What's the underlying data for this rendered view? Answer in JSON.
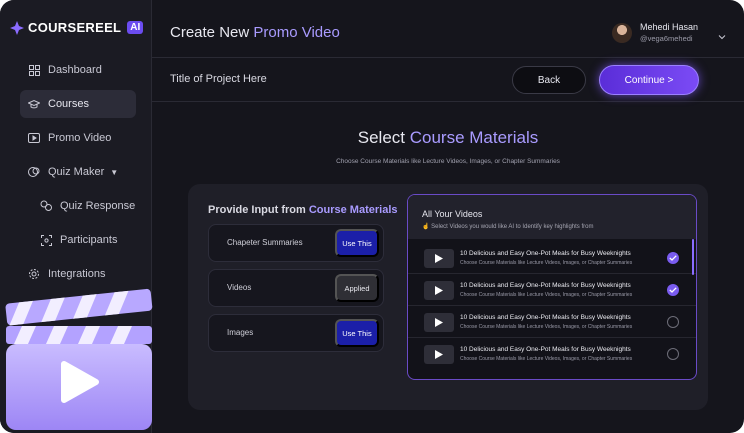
{
  "brand": {
    "name": "COURSEREEL",
    "badge": "AI"
  },
  "sidebar": {
    "items": [
      {
        "label": "Dashboard",
        "icon": "grid-icon"
      },
      {
        "label": "Courses",
        "icon": "graduation-cap-icon",
        "active": true
      },
      {
        "label": "Promo Video",
        "icon": "play-box-icon"
      },
      {
        "label": "Quiz Maker",
        "icon": "quiz-icon",
        "expandable": true
      },
      {
        "label": "Quiz Response",
        "icon": "responses-icon",
        "sub": true
      },
      {
        "label": "Participants",
        "icon": "participants-icon",
        "sub": true
      },
      {
        "label": "Integrations",
        "icon": "gear-icon"
      }
    ]
  },
  "header": {
    "title_prefix": "Create New",
    "title_accent": "Promo Video",
    "user_name": "Mehedi Hasan",
    "user_handle": "@vega6mehedi"
  },
  "toolbar": {
    "project_title": "Title of Project Here",
    "back_label": "Back",
    "continue_label": "Continue >"
  },
  "main": {
    "title_prefix": "Select",
    "title_accent": "Course Materials",
    "subtitle": "Choose Course Materials like Lecture Videos, Images,  or Chapter Summaries",
    "input": {
      "title_prefix": "Provide Input from",
      "title_accent": "Course Materials",
      "options": [
        {
          "label": "Chapeter Summaries",
          "button": "Use This",
          "state": "use"
        },
        {
          "label": "Videos",
          "button": "Applied",
          "state": "applied"
        },
        {
          "label": "Images",
          "button": "Use This",
          "state": "use"
        }
      ]
    },
    "videos": {
      "title": "All Your Videos",
      "hint": "Select Videos you would like AI to Identify key highlights from",
      "items": [
        {
          "title": "10 Delicious and Easy One-Pot Meals for Busy Weeknights",
          "desc": "Choose Course Materials like Lecture Videos, Images,  or Chapter Summaries",
          "selected": true
        },
        {
          "title": "10 Delicious and Easy One-Pot Meals for Busy Weeknights",
          "desc": "Choose Course Materials like Lecture Videos, Images,  or Chapter Summaries",
          "selected": true
        },
        {
          "title": "10 Delicious and Easy One-Pot Meals for Busy Weeknights",
          "desc": "Choose Course Materials like Lecture Videos, Images,  or Chapter Summaries",
          "selected": false
        },
        {
          "title": "10 Delicious and Easy One-Pot Meals for Busy Weeknights",
          "desc": "Choose Course Materials like Lecture Videos, Images,  or Chapter Summaries",
          "selected": false
        }
      ]
    }
  },
  "colors": {
    "accent": "#a99bff",
    "primary": "#6b4cf0",
    "use_button": "#1b1fa8"
  }
}
